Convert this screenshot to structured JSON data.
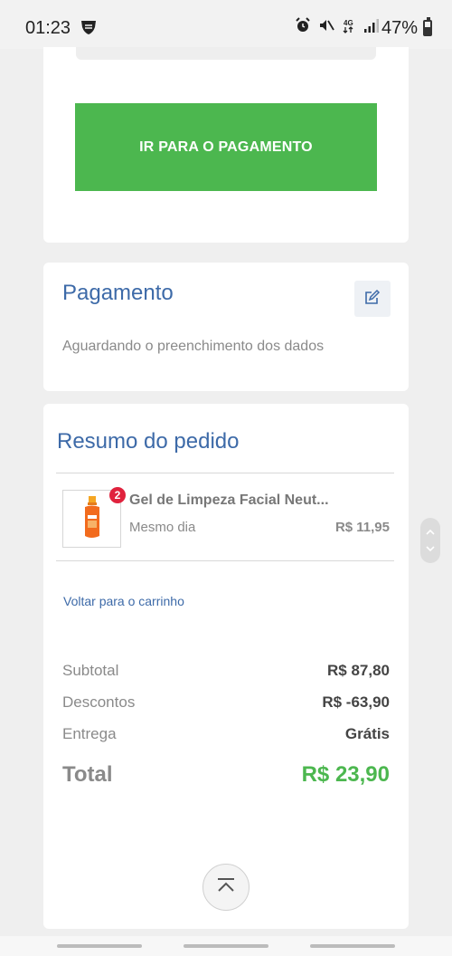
{
  "status_bar": {
    "time": "01:23",
    "battery": "47%"
  },
  "checkout": {
    "pay_button_label": "IR PARA O PAGAMENTO"
  },
  "payment": {
    "title": "Pagamento",
    "status": "Aguardando o preenchimento dos dados",
    "edit_icon": "edit-icon"
  },
  "summary": {
    "title": "Resumo do pedido",
    "product": {
      "name": "Gel de Limpeza Facial Neut...",
      "quantity_badge": "2",
      "delivery": "Mesmo dia",
      "price": "R$ 11,95"
    },
    "back_link": "Voltar para o carrinho",
    "rows": [
      {
        "label": "Subtotal",
        "value": "R$ 87,80"
      },
      {
        "label": "Descontos",
        "value": "R$ -63,90"
      },
      {
        "label": "Entrega",
        "value": "Grátis"
      }
    ],
    "total_label": "Total",
    "total_value": "R$ 23,90"
  },
  "colors": {
    "accent_green": "#4cb74f",
    "title_blue": "#3d6aa8",
    "badge_red": "#e0223d"
  }
}
